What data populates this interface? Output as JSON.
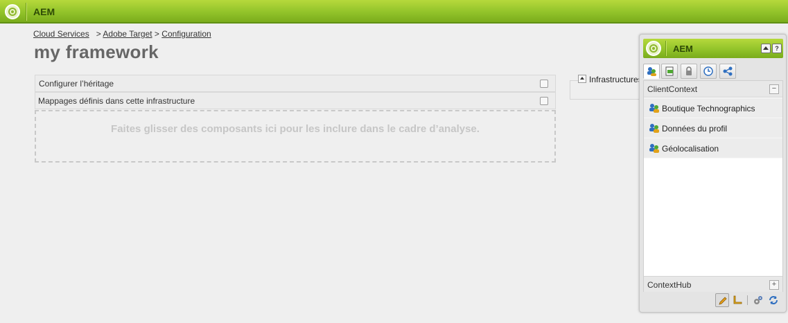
{
  "app": {
    "title": "AEM"
  },
  "breadcrumb": {
    "items": [
      "Cloud Services",
      "Adobe Target",
      "Configuration"
    ],
    "separator": ">"
  },
  "page": {
    "title": "my framework"
  },
  "main": {
    "inherit_label": "Configurer l’héritage",
    "mappings_label": "Mappages définis dans cette infrastructure",
    "dropzone_hint": "Faites glisser des composants ici pour les inclure dans le cadre d’analyse."
  },
  "infrastructures": {
    "label": "Infrastructures"
  },
  "client_context": {
    "title": "AEM",
    "help_label": "?",
    "section_title": "ClientContext",
    "collapse_label": "−",
    "items": [
      "Boutique Technographics",
      "Données du profil",
      "Géolocalisation"
    ],
    "hub_title": "ContextHub",
    "expand_label": "+",
    "tabs": [
      "profile-stores-icon",
      "page-data-icon",
      "lock-icon",
      "clock-icon",
      "segments-icon"
    ],
    "footer_icons": [
      "pencil-icon",
      "ruler-icon",
      "gear-icon",
      "refresh-icon"
    ]
  },
  "colors": {
    "brand_green": "#92c32a",
    "brand_dark": "#2e4a06"
  }
}
